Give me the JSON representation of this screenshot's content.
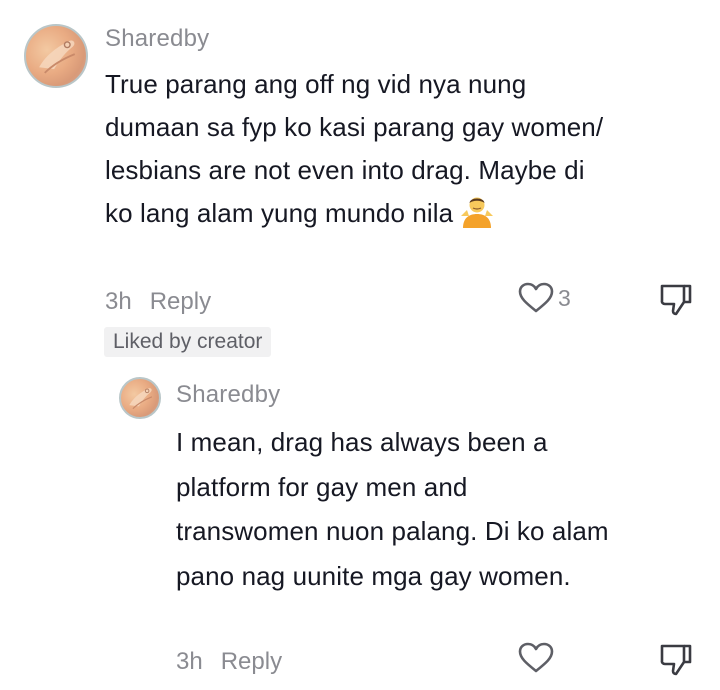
{
  "comments": [
    {
      "username": "Sharedby",
      "text": "True parang ang off ng vid nya nung dumaan sa fyp ko kasi parang gay women/ lesbians are not even into drag. Maybe di ko lang alam yung mundo nila",
      "emoji": "person-shrugging-icon",
      "time": "3h",
      "reply_label": "Reply",
      "like_count": "3",
      "badge": "Liked by creator"
    }
  ],
  "replies": [
    {
      "username": "Sharedby",
      "text": "I mean, drag has always been a platform for gay men and transwomen nuon palang. Di ko alam pano nag uunite mga gay women.",
      "time": "3h",
      "reply_label": "Reply"
    }
  ],
  "colors": {
    "text": "#161823",
    "muted": "#8a8b91",
    "badge_bg": "#f1f1f2"
  }
}
